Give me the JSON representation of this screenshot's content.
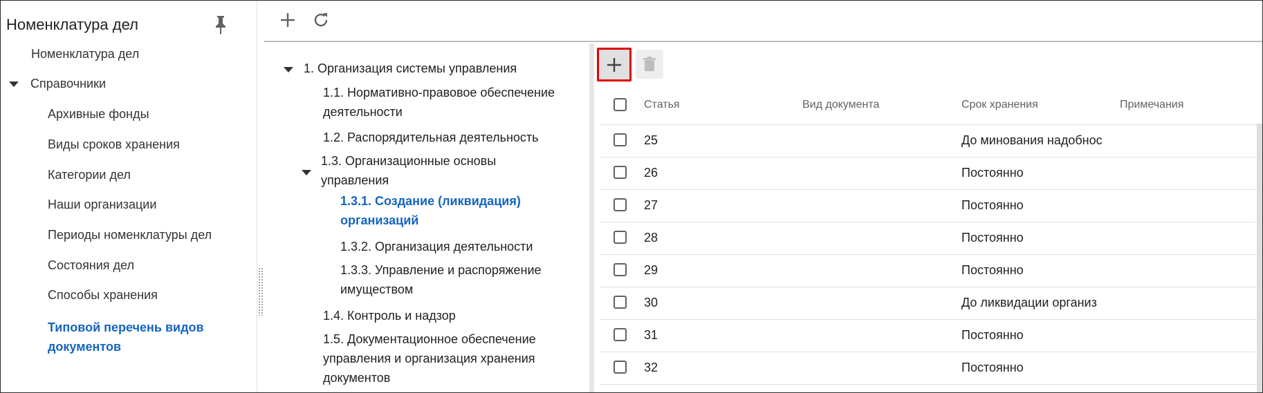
{
  "sidebar": {
    "title": "Номенклатура дел",
    "items": [
      {
        "label": "Номенклатура дел"
      },
      {
        "label": "Справочники"
      },
      {
        "label": "Архивные фонды"
      },
      {
        "label": "Виды сроков хранения"
      },
      {
        "label": "Категории дел"
      },
      {
        "label": "Наши организации"
      },
      {
        "label": "Периоды номенклатуры дел"
      },
      {
        "label": "Состояния дел"
      },
      {
        "label": "Способы хранения"
      },
      {
        "label_line1": "Типовой перечень видов",
        "label_line2": "документов"
      }
    ]
  },
  "toolbar": {
    "add_icon": "plus-icon",
    "refresh_icon": "refresh-icon"
  },
  "tree": {
    "items": [
      {
        "label": "1. Организация системы управления"
      },
      {
        "line1": "1.1. Нормативно-правовое обеспечение",
        "line2": "деятельности"
      },
      {
        "label": "1.2. Распорядительная деятельность"
      },
      {
        "line1": "1.3. Организационные основы",
        "line2": "управления"
      },
      {
        "line1": "1.3.1. Создание (ликвидация)",
        "line2": "организаций"
      },
      {
        "label": "1.3.2. Организация деятельности"
      },
      {
        "line1": "1.3.3. Управление и распоряжение",
        "line2": "имуществом"
      },
      {
        "label": "1.4. Контроль и надзор"
      },
      {
        "line1": "1.5. Документационное обеспечение",
        "line2": "управления и организация хранения",
        "line3": "документов"
      }
    ]
  },
  "grid": {
    "add_icon": "plus-icon",
    "delete_icon": "trash-icon",
    "columns": [
      "Статья",
      "Вид документа",
      "Срок хранения",
      "Примечания"
    ],
    "rows": [
      {
        "article": "25",
        "doc_type": "",
        "term": "До минования надобнос",
        "notes": ""
      },
      {
        "article": "26",
        "doc_type": "",
        "term": "Постоянно",
        "notes": ""
      },
      {
        "article": "27",
        "doc_type": "",
        "term": "Постоянно",
        "notes": ""
      },
      {
        "article": "28",
        "doc_type": "",
        "term": "Постоянно",
        "notes": ""
      },
      {
        "article": "29",
        "doc_type": "",
        "term": "Постоянно",
        "notes": ""
      },
      {
        "article": "30",
        "doc_type": "",
        "term": "До ликвидации организ",
        "notes": ""
      },
      {
        "article": "31",
        "doc_type": "",
        "term": "Постоянно",
        "notes": ""
      },
      {
        "article": "32",
        "doc_type": "",
        "term": "Постоянно",
        "notes": ""
      }
    ]
  },
  "colors": {
    "accent": "#1565c0",
    "highlight_border": "#e00000"
  }
}
